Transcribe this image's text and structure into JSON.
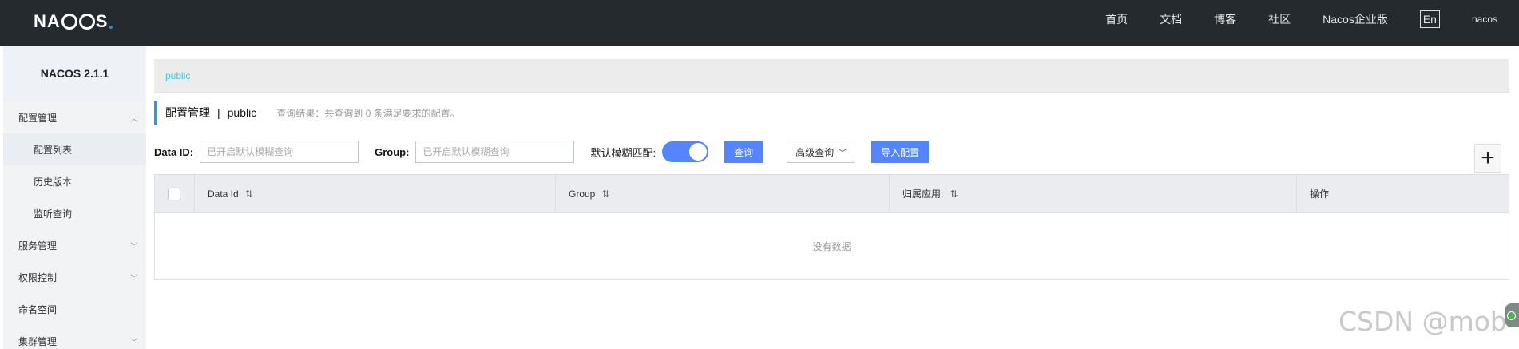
{
  "logo": {
    "text_1": "NA",
    "text_2": "S"
  },
  "topnav": {
    "items": [
      "首页",
      "文档",
      "博客",
      "社区",
      "Nacos企业版"
    ],
    "lang": "En",
    "user": "nacos"
  },
  "sidebar": {
    "title": "NACOS 2.1.1",
    "items": [
      {
        "label": "配置管理",
        "chevron": "up"
      },
      {
        "label": "配置列表",
        "sub": true
      },
      {
        "label": "历史版本",
        "sub": true
      },
      {
        "label": "监听查询",
        "sub": true
      },
      {
        "label": "服务管理",
        "chevron": "down"
      },
      {
        "label": "权限控制",
        "chevron": "down"
      },
      {
        "label": "命名空间"
      },
      {
        "label": "集群管理",
        "chevron": "down"
      }
    ]
  },
  "breadcrumb": {
    "namespace": "public"
  },
  "title": {
    "main": "配置管理",
    "separator": "|",
    "namespace": "public",
    "hint": "查询结果：共查询到 0 条满足要求的配置。"
  },
  "filters": {
    "dataid_label": "Data ID:",
    "dataid_placeholder": "已开启默认模糊查询",
    "group_label": "Group:",
    "group_placeholder": "已开启默认模糊查询",
    "fuzzy_label": "默认模糊匹配:",
    "fuzzy_on": true,
    "query_btn": "查询",
    "advanced_btn": "高级查询",
    "import_btn": "导入配置",
    "add_btn": "+"
  },
  "table": {
    "columns": [
      "Data Id",
      "Group",
      "归属应用:",
      "操作"
    ],
    "empty": "没有数据"
  },
  "watermark": "CSDN @mob",
  "colors": {
    "accent": "#5584ff",
    "topbar": "#252a2f",
    "link": "#33cde5"
  }
}
